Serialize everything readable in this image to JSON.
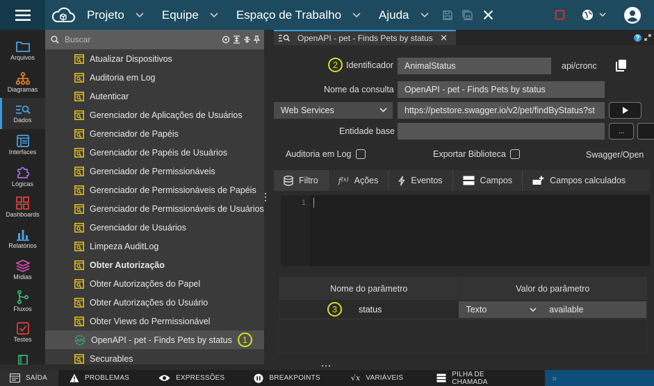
{
  "topbar": {
    "menus": [
      "Projeto",
      "Equipe",
      "Espaço de Trabalho",
      "Ajuda"
    ]
  },
  "nav": [
    {
      "label": "Arquivos",
      "icon": "folder-icon"
    },
    {
      "label": "Diagramas",
      "icon": "diagram-icon"
    },
    {
      "label": "Dados",
      "icon": "data-search-icon",
      "active": true
    },
    {
      "label": "Interfaces",
      "icon": "interfaces-icon"
    },
    {
      "label": "Lógicas",
      "icon": "puzzle-icon"
    },
    {
      "label": "Dashboards",
      "icon": "dashboards-icon"
    },
    {
      "label": "Relatórios",
      "icon": "reports-icon"
    },
    {
      "label": "Mídias",
      "icon": "media-icon"
    },
    {
      "label": "Fluxos",
      "icon": "flows-icon"
    },
    {
      "label": "Testes",
      "icon": "tests-icon"
    }
  ],
  "tree": {
    "search_placeholder": "Buscar",
    "items": [
      {
        "label": "Atualizar Dispositivos"
      },
      {
        "label": "Auditoria em Log"
      },
      {
        "label": "Autenticar"
      },
      {
        "label": "Gerenciador de Aplicações de Usuários"
      },
      {
        "label": "Gerenciador de Papéis"
      },
      {
        "label": "Gerenciador de Papéis de Usuários"
      },
      {
        "label": "Gerenciador de Permissionáveis"
      },
      {
        "label": "Gerenciador de Permissionáveis de Papéis"
      },
      {
        "label": "Gerenciador de Permissionáveis de Usuários"
      },
      {
        "label": "Gerenciador de Usuários"
      },
      {
        "label": "Limpeza AuditLog"
      },
      {
        "label": "Obter Autorização",
        "bold": true
      },
      {
        "label": "Obter Autorizações do Papel"
      },
      {
        "label": "Obter Autorizações do Usuário"
      },
      {
        "label": "Obter Views do Permissionável"
      },
      {
        "label": "OpenAPI - pet - Finds Pets by status",
        "selected": true,
        "api": true,
        "badge": "1"
      },
      {
        "label": "Securables"
      }
    ]
  },
  "editor_tab": {
    "label": "OpenAPI - pet - Finds Pets by status",
    "close": "✕"
  },
  "form": {
    "badge_id": "2",
    "identifier_label": "Identificador",
    "identifier_value": "AnimalStatus",
    "api_path": "api/cronc",
    "query_name_label": "Nome da consulta",
    "query_name_value": "OpenAPI - pet - Finds Pets by status",
    "source_select": "Web Services",
    "url_value": "https://petstore.swagger.io/v2/pet/findByStatus?st",
    "base_entity_label": "Entidade base",
    "base_entity_value": "",
    "base_entity_button": "...",
    "audit_label": "Auditoria em Log",
    "export_label": "Exportar Biblioteca",
    "swagger_label": "Swagger/Open"
  },
  "subtabs": [
    {
      "label": "Filtro",
      "icon": "database-icon",
      "active": true
    },
    {
      "label": "Ações",
      "icon": "function-icon"
    },
    {
      "label": "Eventos",
      "icon": "lightning-icon"
    },
    {
      "label": "Campos",
      "icon": "fields-icon"
    },
    {
      "label": "Campos calculados",
      "icon": "add-field-icon"
    }
  ],
  "code_editor": {
    "line_numbers": [
      "1"
    ]
  },
  "params": {
    "headers": [
      "Nome do parâmetro",
      "Valor do parâmetro"
    ],
    "rows": [
      {
        "badge": "3",
        "name": "status",
        "type": "Texto",
        "value": "available"
      }
    ]
  },
  "bottombar": [
    {
      "label": "SAÍDA",
      "icon": "output-icon",
      "active": true
    },
    {
      "label": "PROBLEMAS",
      "icon": "warning-icon"
    },
    {
      "label": "EXPRESSÕES",
      "icon": "eye-icon"
    },
    {
      "label": "BREAKPOINTS",
      "icon": "pause-icon"
    },
    {
      "label": "VARIÁVEIS",
      "icon": "variable-icon"
    },
    {
      "label": "PILHA DE CHAMADA",
      "icon": "stack-icon"
    }
  ],
  "bottom_expand": "»",
  "colors": {
    "accent": "#3a9ad9",
    "topbar": "#1d4a5e",
    "badge": "#d6e021",
    "tree_icon": "#e8c21f"
  }
}
